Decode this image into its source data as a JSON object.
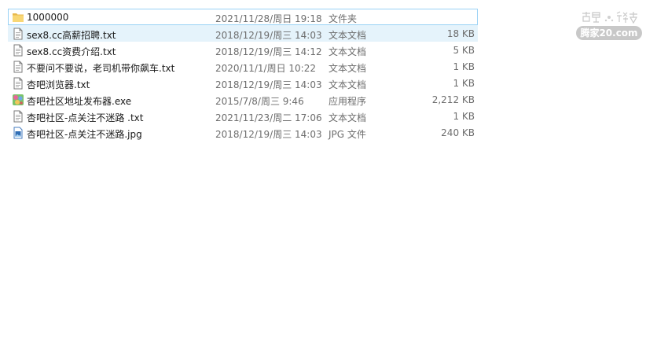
{
  "files": [
    {
      "name": "1000000",
      "date": "2021/11/28/周日 19:18",
      "type": "文件夹",
      "size": "",
      "icon": "folder-icon",
      "state": "focused"
    },
    {
      "name": "sex8.cc高薪招聘.txt",
      "date": "2018/12/19/周三 14:03",
      "type": "文本文档",
      "size": "18 KB",
      "icon": "text-file-icon",
      "state": "selected"
    },
    {
      "name": "sex8.cc资费介绍.txt",
      "date": "2018/12/19/周三 14:12",
      "type": "文本文档",
      "size": "5 KB",
      "icon": "text-file-icon",
      "state": ""
    },
    {
      "name": "不要问不要说，老司机带你飙车.txt",
      "date": "2020/11/1/周日 10:22",
      "type": "文本文档",
      "size": "1 KB",
      "icon": "text-file-icon",
      "state": ""
    },
    {
      "name": "杏吧浏览器.txt",
      "date": "2018/12/19/周三 14:03",
      "type": "文本文档",
      "size": "1 KB",
      "icon": "text-file-icon",
      "state": ""
    },
    {
      "name": "杏吧社区地址发布器.exe",
      "date": "2015/7/8/周三 9:46",
      "type": "应用程序",
      "size": "2,212 KB",
      "icon": "application-icon",
      "state": ""
    },
    {
      "name": "杏吧社区-点关注不迷路 .txt",
      "date": "2021/11/23/周二 17:06",
      "type": "文本文档",
      "size": "1 KB",
      "icon": "text-file-icon",
      "state": ""
    },
    {
      "name": "杏吧社区-点关注不迷路.jpg",
      "date": "2018/12/19/周三 14:03",
      "type": "JPG 文件",
      "size": "240 KB",
      "icon": "image-file-icon",
      "state": ""
    }
  ],
  "watermark": {
    "domain": "腾家20.com",
    "top_text": "吉吧 论坛",
    "color": "#c8c8c8"
  },
  "colors": {
    "selected_bg": "#e5f3fb",
    "focus_border": "#99d1f5",
    "folder": "#f8d775",
    "secondary_text": "#6d6d6d"
  }
}
